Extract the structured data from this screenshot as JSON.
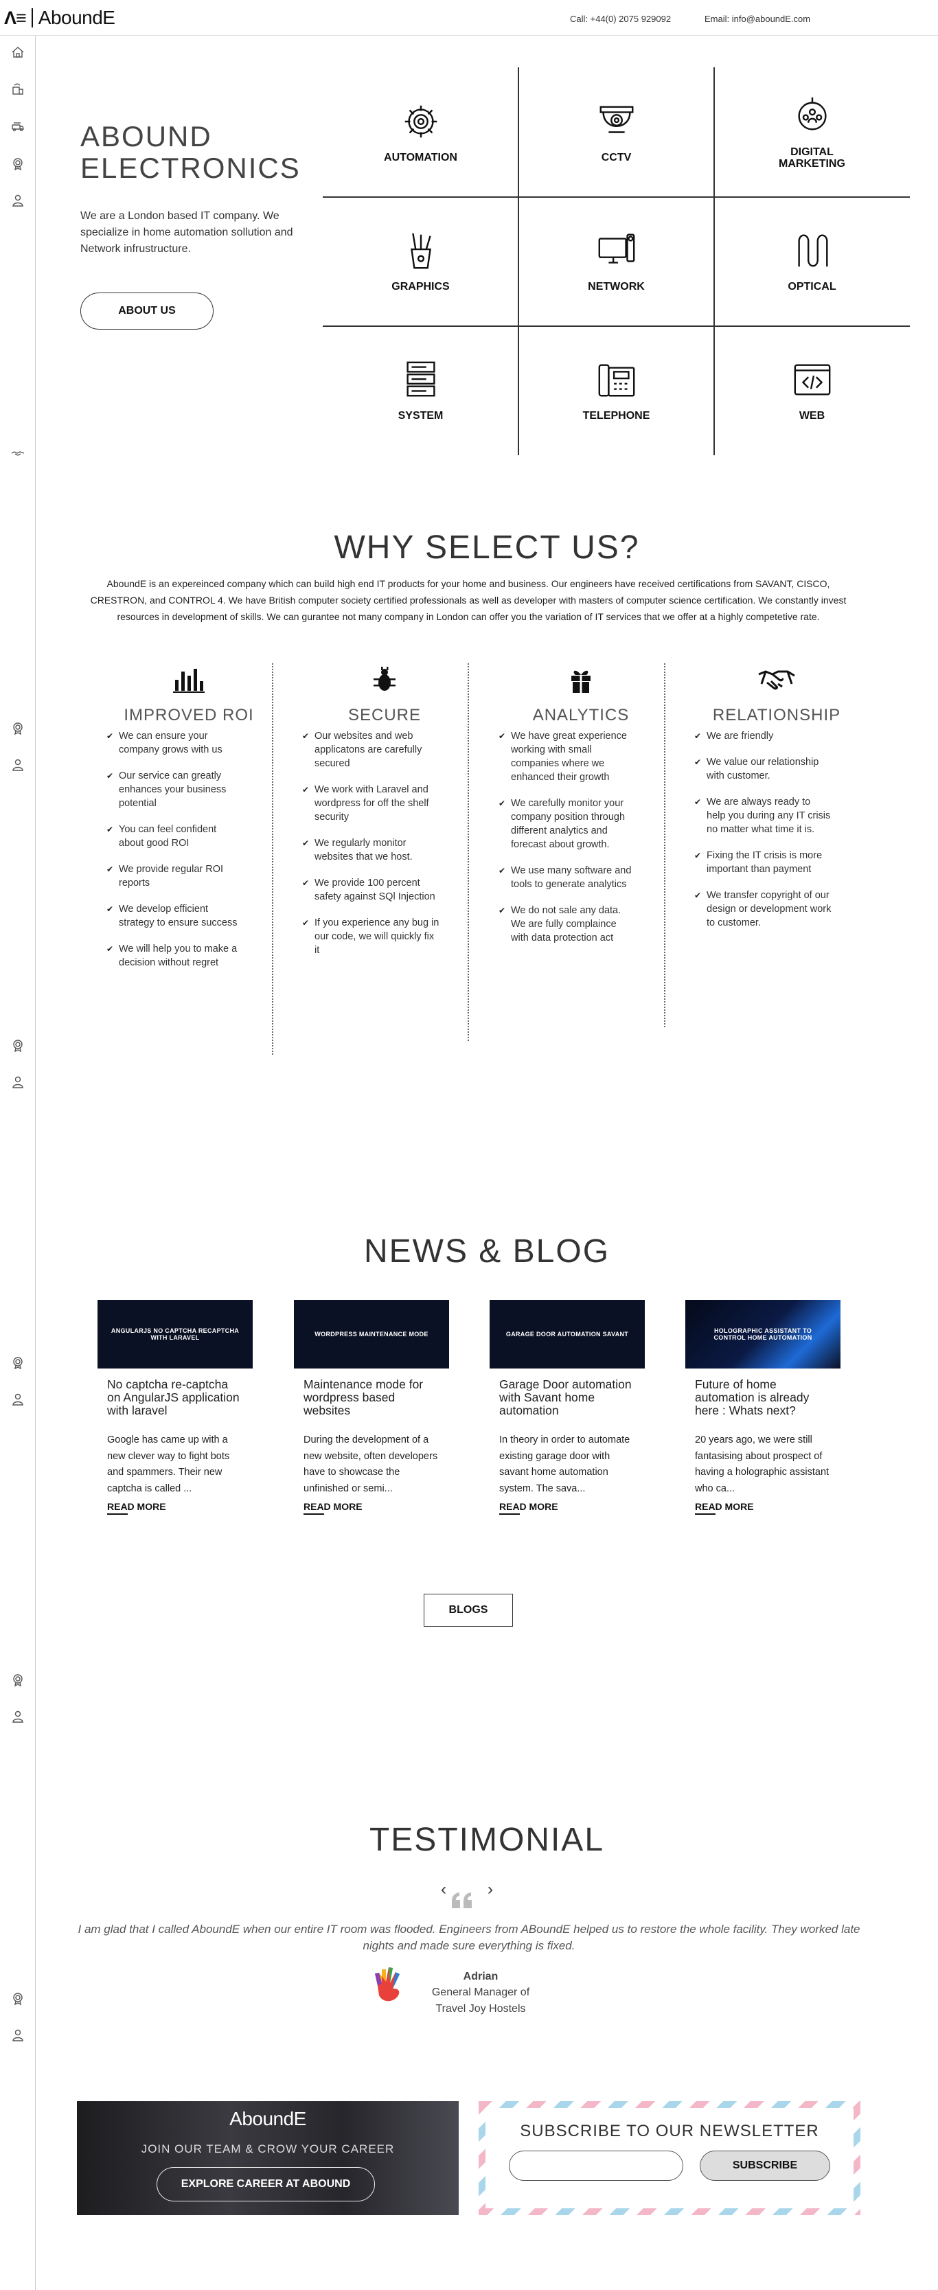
{
  "header": {
    "logo_mark": "Λ≡",
    "logo_word": "AboundE",
    "phone": "Call: +44(0) 2075 929092",
    "email": "Email: info@aboundE.com"
  },
  "sidebar": {
    "icons": [
      "home-icon",
      "building-icon",
      "fleet-icon",
      "badge-icon",
      "user-icon",
      "handshake-icon",
      "badge-icon",
      "user-icon",
      "badge-icon",
      "user-icon",
      "badge-icon",
      "user-icon",
      "badge-icon",
      "user-icon",
      "badge-icon",
      "user-icon"
    ]
  },
  "hero": {
    "title_line1": "ABOUND",
    "title_line2": "ELECTRONICS",
    "text": "We are a London based IT company. We specialize in home automation sollution and Network infrustructure.",
    "about_button": "ABOUT US"
  },
  "services": [
    {
      "label": "AUTOMATION",
      "icon": "gear-icon"
    },
    {
      "label": "CCTV",
      "icon": "cctv-camera-icon"
    },
    {
      "label": "DIGITAL\nMARKETING",
      "icon": "people-network-icon"
    },
    {
      "label": "GRAPHICS",
      "icon": "pencil-cup-icon"
    },
    {
      "label": "NETWORK",
      "icon": "computer-icon"
    },
    {
      "label": "OPTICAL",
      "icon": "optical-fiber-icon"
    },
    {
      "label": "SYSTEM",
      "icon": "server-icon"
    },
    {
      "label": "TELEPHONE",
      "icon": "telephone-icon"
    },
    {
      "label": "WEB",
      "icon": "code-window-icon"
    }
  ],
  "why": {
    "title": "WHY SELECT US?",
    "text": "AboundE is an expereinced company which can build high end IT products for your home and business. Our engineers have received certifications from SAVANT, CISCO, CRESTRON, and CONTROL 4. We have British computer society certified professionals as well as developer with masters of computer science certification. We constantly invest resources in development of skills. We can gurantee not many company in London can offer you the variation of IT services that we offer at a highly competetive rate.",
    "features": [
      {
        "title": "IMPROVED ROI",
        "icon": "bar-chart-icon",
        "items": [
          "We can ensure your company grows with us",
          "Our service can greatly enhances your business potential",
          "You can feel confident about good ROI",
          "We provide regular ROI reports",
          "We develop efficient strategy to ensure success",
          "We will help you to make a decision without regret"
        ]
      },
      {
        "title": "SECURE",
        "icon": "bug-icon",
        "items": [
          "Our websites and web applicatons are carefully secured",
          "We work with Laravel and wordpress for off the shelf security",
          "We regularly monitor websites that we host.",
          "We provide 100 percent safety against SQl Injection",
          "If you experience any bug in our code, we will quickly fix it"
        ]
      },
      {
        "title": "ANALYTICS",
        "icon": "gift-icon",
        "items": [
          "We have great experience working with small companies where we enhanced their growth",
          "We carefully monitor your company position through different analytics and forecast about growth.",
          "We use many software and tools to generate analytics",
          "We do not sale any data. We are fully complaince with data protection act"
        ]
      },
      {
        "title": "RELATIONSHIP",
        "icon": "handshake-icon",
        "items": [
          "We are friendly",
          "We value our relationship with customer.",
          "We are always ready to help you during any IT crisis no matter what time it is.",
          "Fixing the IT crisis is more important than payment",
          "We transfer copyright of our design or development work to customer."
        ]
      }
    ]
  },
  "blog": {
    "title": "NEWS & BLOG",
    "posts": [
      {
        "thumb": "ANGULARJS NO CAPTCHA RECAPTCHA WITH LARAVEL",
        "title": "No captcha re-captcha on AngularJS application with laravel",
        "excerpt": "Google has came up with a new clever way to fight bots and spammers. Their new captcha is called ...",
        "more": "READ MORE"
      },
      {
        "thumb": "WORDPRESS MAINTENANCE MODE",
        "title": "Maintenance mode for wordpress based websites",
        "excerpt": "During the development of a new website, often developers have to showcase the unfinished or semi...",
        "more": "READ MORE"
      },
      {
        "thumb": "GARAGE DOOR AUTOMATION SAVANT",
        "title": "Garage Door automation with Savant home automation",
        "excerpt": "In theory in order to automate existing garage door with savant home automation system. The sava...",
        "more": "READ MORE"
      },
      {
        "thumb": "HOLOGRAPHIC ASSISTANT TO CONTROL HOME AUTOMATION",
        "title": "Future of home automation is already here : Whats next?",
        "excerpt": "20 years ago, we were still fantasising about prospect of having a holographic assistant who ca...",
        "more": "READ MORE"
      }
    ],
    "button": "BLOGS"
  },
  "testimonial": {
    "title": "TESTIMONIAL",
    "prev": "‹",
    "next": "›",
    "quote": "I am glad that I called AboundE when our entire IT room was flooded. Engineers from ABoundE helped us to restore the whole facility. They worked late nights and made sure everything is fixed.",
    "name": "Adrian",
    "role_line1": "General Manager of",
    "role_line2": "Travel Joy Hostels"
  },
  "career": {
    "logo": "AboundE",
    "tagline": "JOIN OUR TEAM & CROW YOUR CAREER",
    "button": "EXPLORE CAREER AT ABOUND"
  },
  "newsletter": {
    "title": "SUBSCRIBE TO OUR NEWSLETTER",
    "input_value": "",
    "button": "SUBSCRIBE"
  }
}
